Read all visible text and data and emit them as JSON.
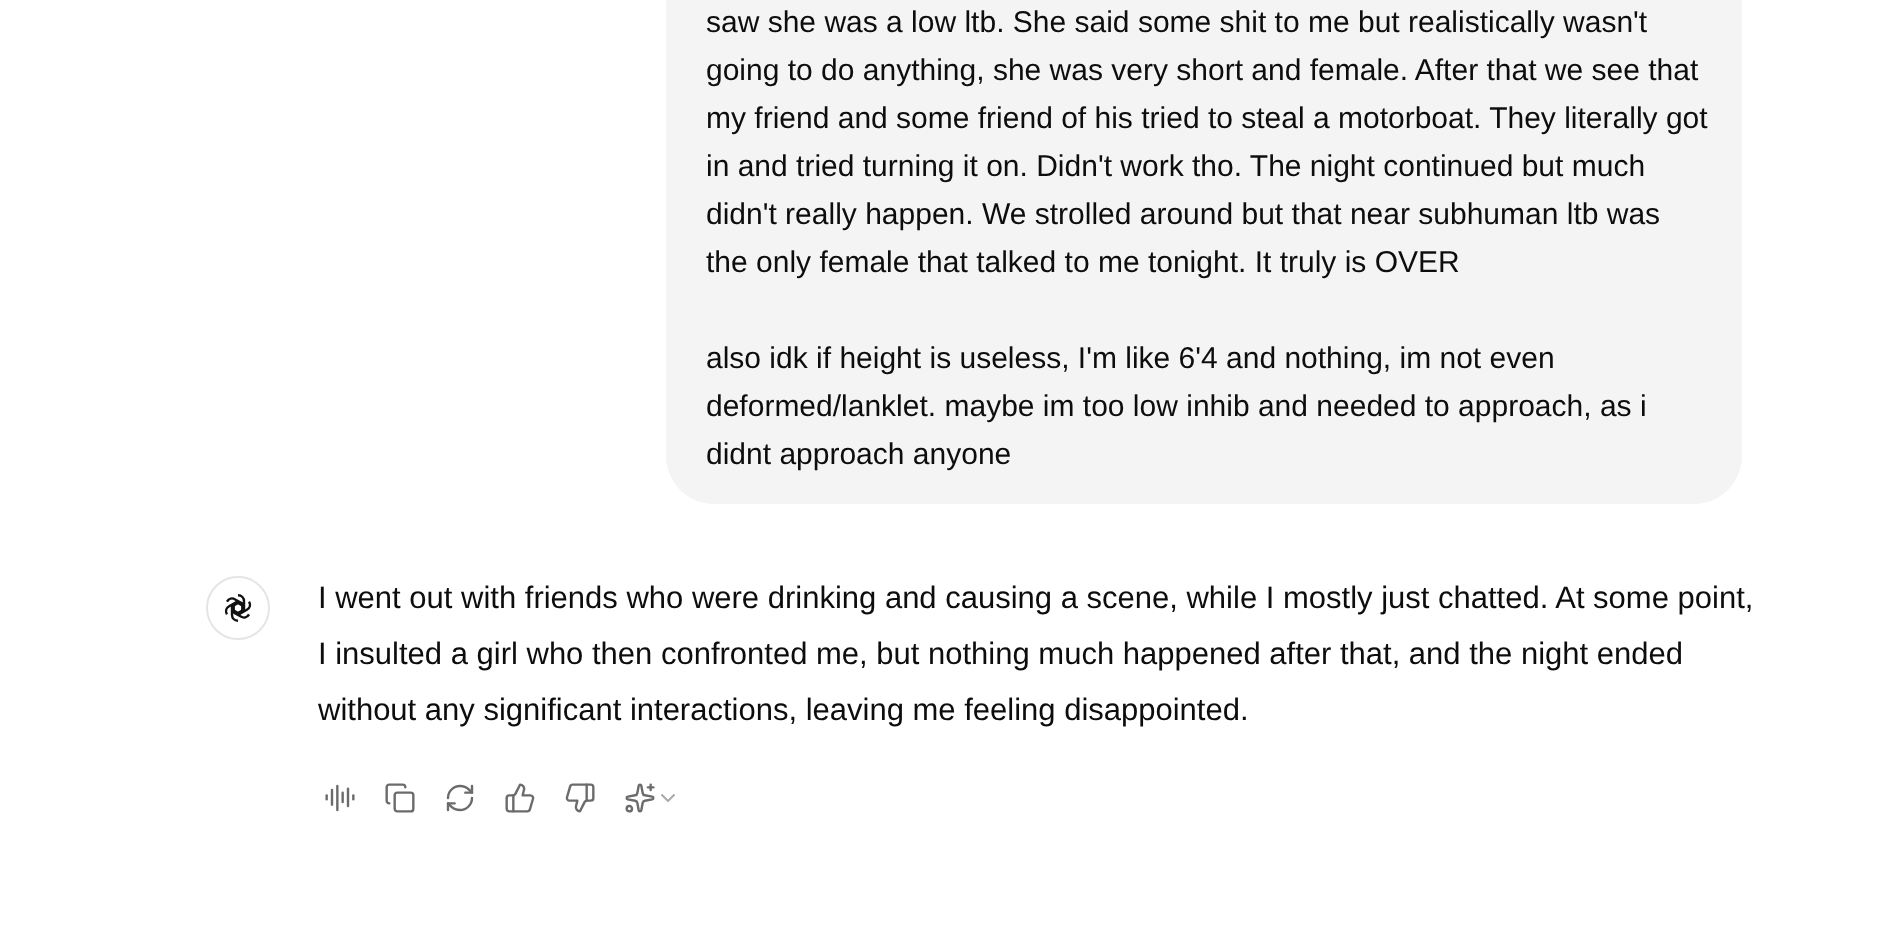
{
  "user_message": {
    "paragraphs": [
      "saw she was a low ltb. She said some shit to me but realistically wasn't going to do anything, she was very short and female. After that we see that my friend and some friend of his tried to steal a motorboat. They literally got in and tried turning it on. Didn't work tho. The night continued but much didn't really happen. We strolled around but that near subhuman ltb was the only female that talked to me tonight. It truly is OVER",
      "also idk if height is useless, I'm like 6'4 and nothing, im not even deformed/lanklet. maybe im too low inhib and needed to approach, as i didnt approach anyone"
    ]
  },
  "assistant_message": {
    "text": "I went out with friends who were drinking and causing a scene, while I mostly just chatted. At some point, I insulted a girl who then confronted me, but nothing much happened after that, and the night ended without any significant interactions, leaving me feeling disappointed."
  },
  "actions": [
    {
      "kind": "read-aloud"
    },
    {
      "kind": "copy"
    },
    {
      "kind": "regenerate"
    },
    {
      "kind": "like"
    },
    {
      "kind": "dislike"
    },
    {
      "kind": "model"
    }
  ]
}
